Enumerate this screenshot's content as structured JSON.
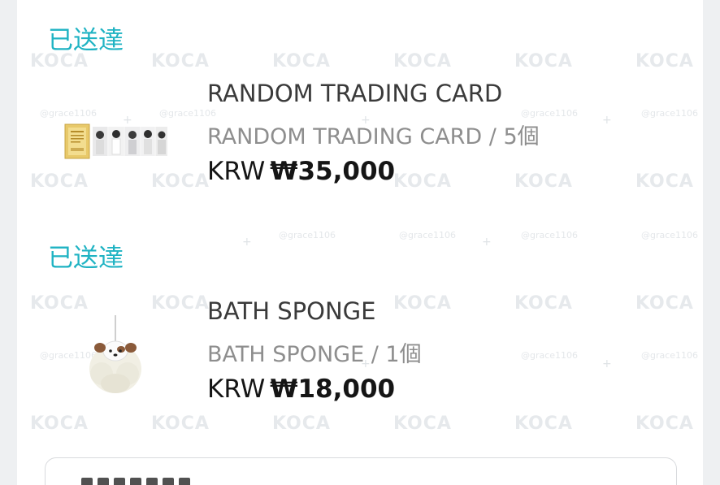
{
  "orders": [
    {
      "status": "已送達",
      "name": "RANDOM TRADING CARD",
      "variant": "RANDOM TRADING CARD / 5個",
      "currency": "KRW",
      "amount": "₩35,000"
    },
    {
      "status": "已送達",
      "name": "BATH SPONGE",
      "variant": "BATH SPONGE / 1個",
      "currency": "KRW",
      "amount": "₩18,000"
    }
  ],
  "watermark": {
    "logo": "KOCA",
    "handle": "@grace1106"
  },
  "colors": {
    "status": "#1fb3c3",
    "price": "#151515",
    "variant": "#8e8e8e"
  }
}
